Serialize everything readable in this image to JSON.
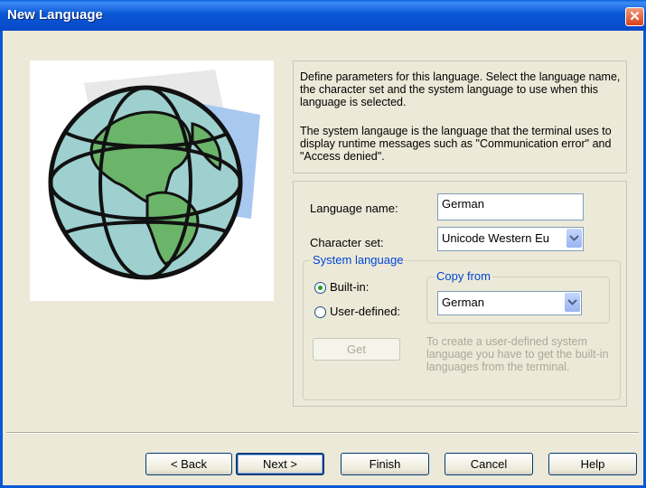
{
  "window": {
    "title": "New Language",
    "close_glyph": "✕"
  },
  "description": {
    "para1": "Define parameters for this language. Select the language name, the character set and the system language to use when this language is selected.",
    "para2": "The system langauge is the language that the terminal uses to display runtime messages such as \"Communication error\" and \"Access denied\"."
  },
  "form": {
    "language_name_label": "Language name:",
    "language_name_value": "German",
    "character_set_label": "Character set:",
    "character_set_value": "Unicode Western Eu",
    "system_language": {
      "legend": "System language",
      "builtin_label": "Built-in:",
      "userdefined_label": "User-defined:",
      "selected": "Built-in",
      "copy_from": {
        "legend": "Copy from",
        "value": "German"
      },
      "get_button_label": "Get",
      "hint": "To create a user-defined system language you have to get the built-in languages from the terminal."
    }
  },
  "buttons": {
    "back": "< Back",
    "next": "Next >",
    "finish": "Finish",
    "cancel": "Cancel",
    "help": "Help"
  },
  "icons": {
    "globe": "globe-illustration",
    "dropdown": "chevron-down-icon",
    "close": "close-icon"
  },
  "colors": {
    "title_bar": "#0b58d6",
    "dialog_bg": "#ece9d8",
    "group_legend": "#0046d5",
    "close_button": "#d9411c"
  }
}
